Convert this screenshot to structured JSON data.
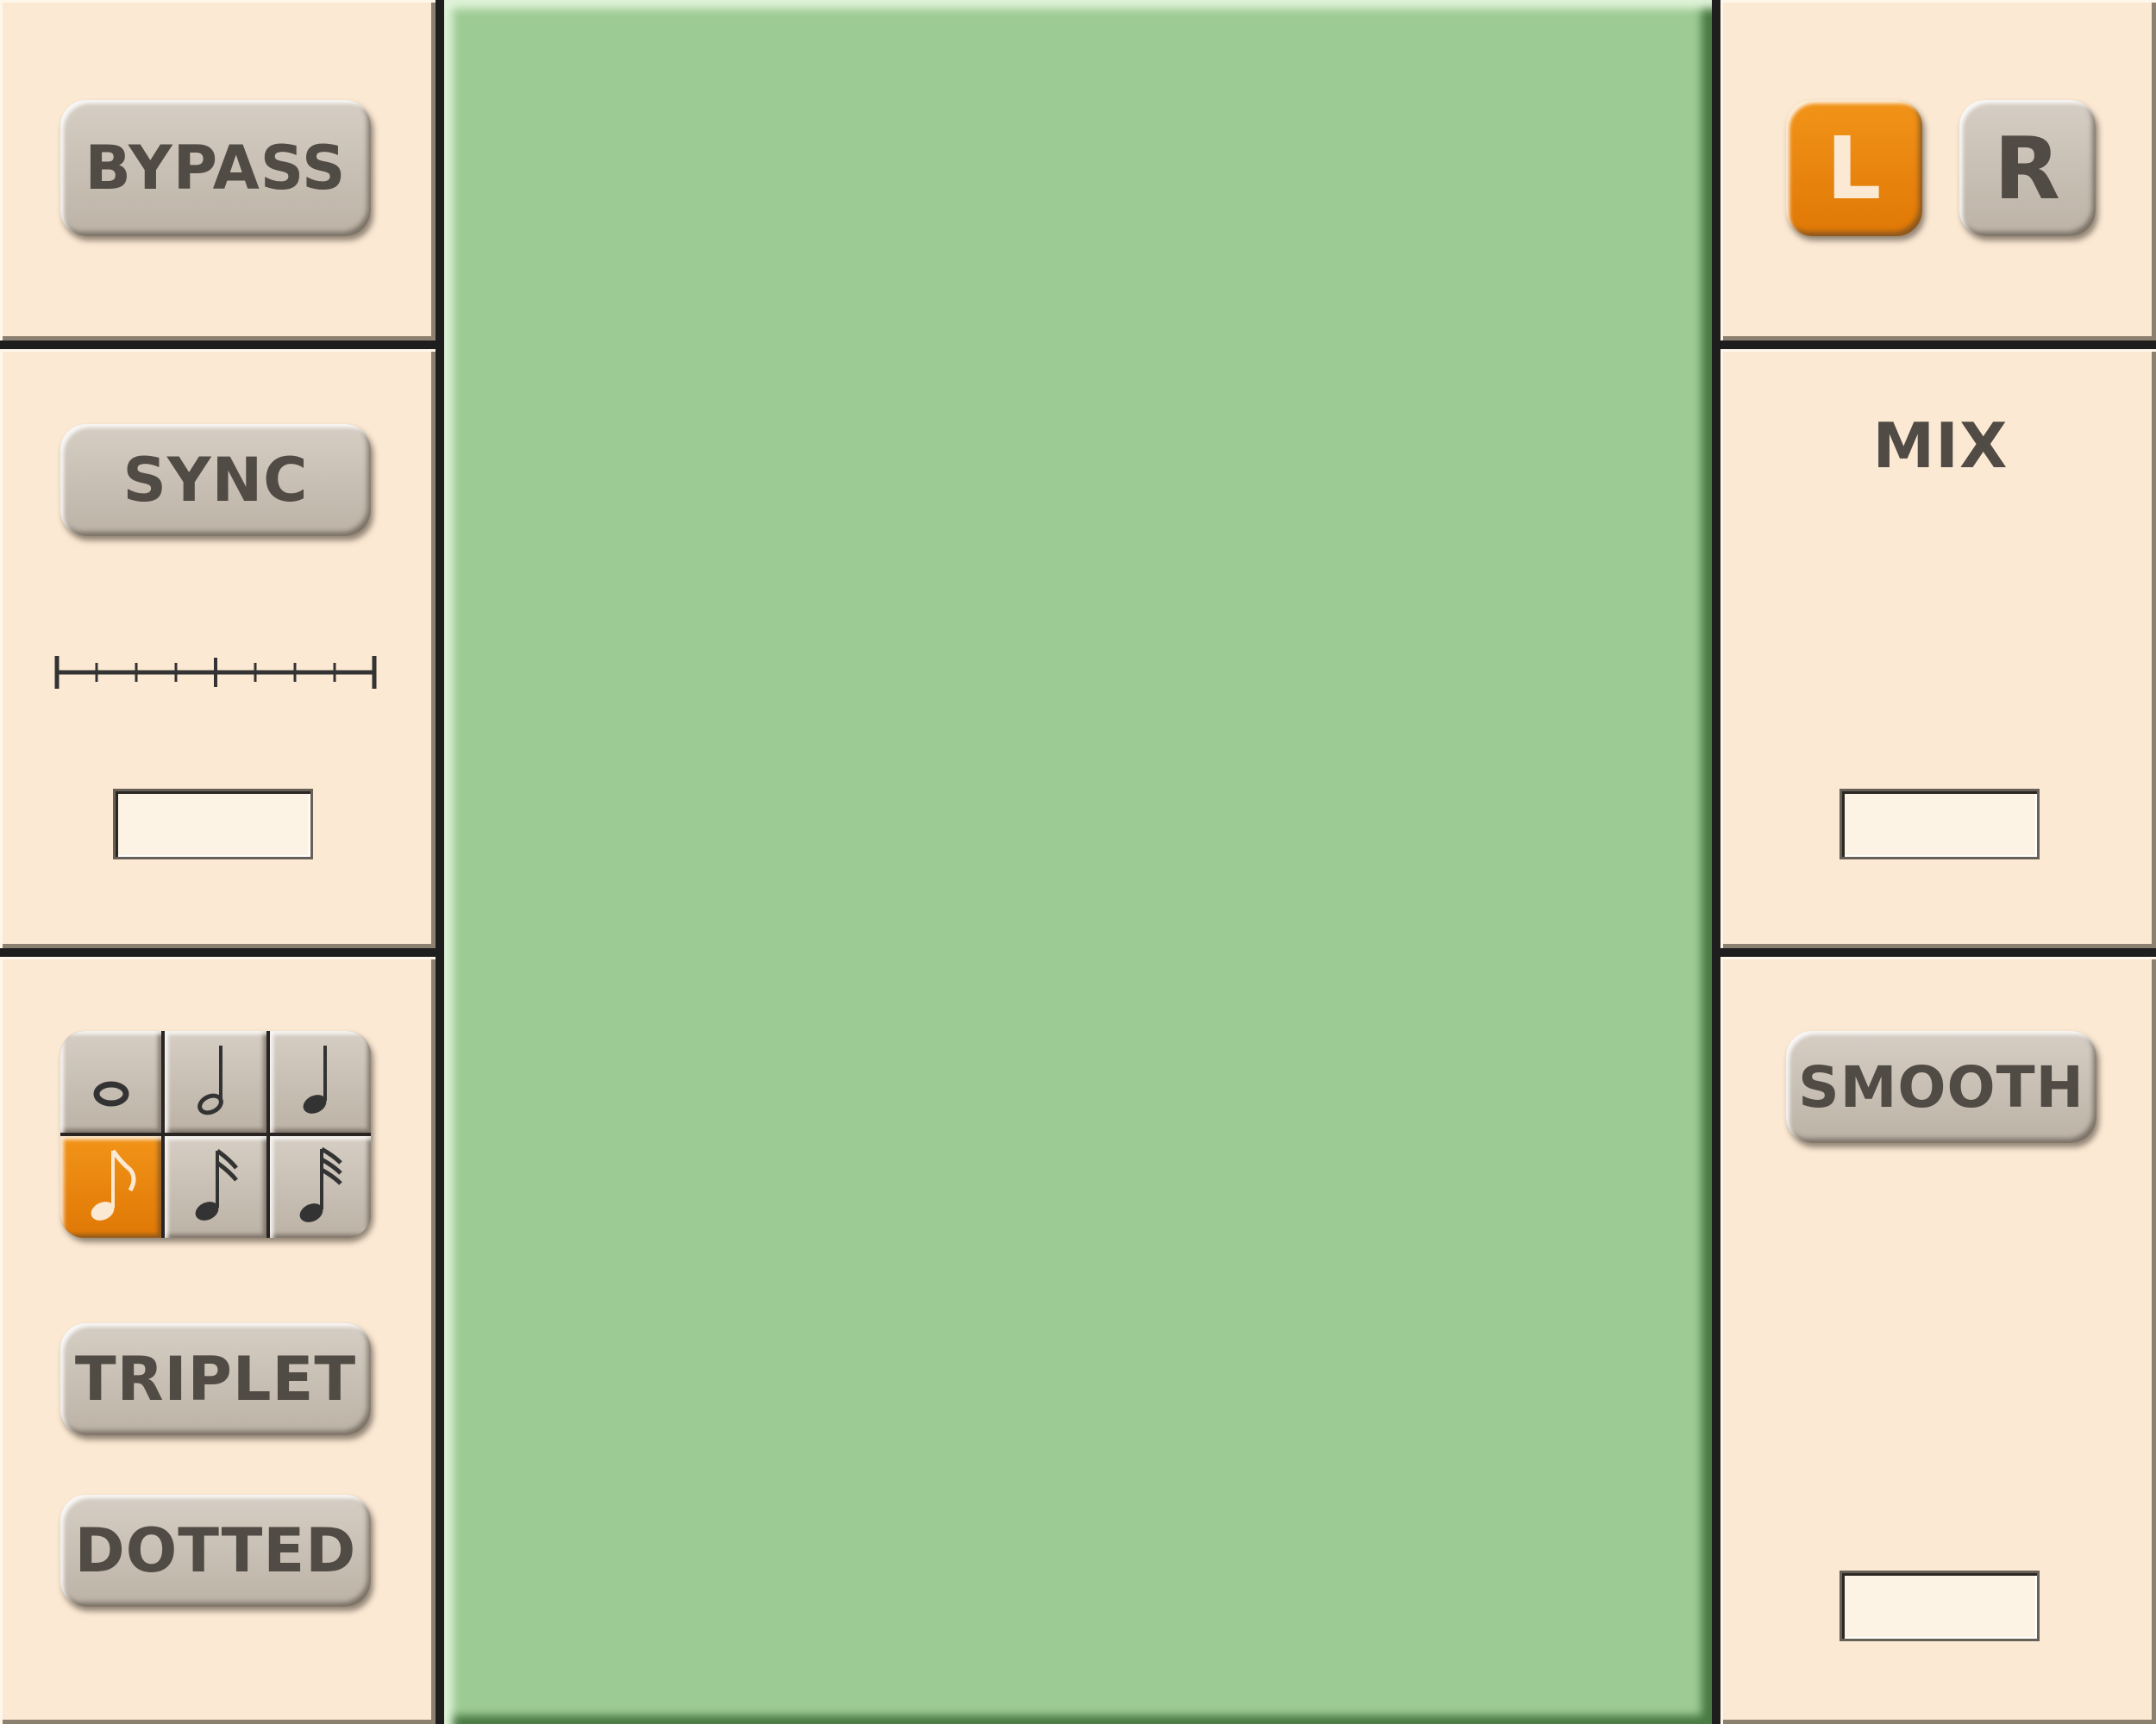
{
  "left": {
    "bypass_label": "BYPASS",
    "sync_label": "SYNC",
    "sync_value": "",
    "note_values": [
      "whole-note-icon",
      "half-note-icon",
      "quarter-note-icon",
      "eighth-note-icon",
      "sixteenth-note-icon",
      "thirty-second-note-icon"
    ],
    "selected_note": "eighth-note-icon",
    "triplet_label": "TRIPLET",
    "dotted_label": "DOTTED"
  },
  "right": {
    "channel_l_label": "L",
    "channel_r_label": "R",
    "selected_channel": "L",
    "mix_label": "MIX",
    "mix_value": "",
    "smooth_label": "SMOOTH",
    "smooth_value": ""
  },
  "colors": {
    "panel": "#fbe9d3",
    "button": "#c8bfb4",
    "active": "#ef8a0f",
    "display": "#9dcb94",
    "text": "#514b45"
  }
}
